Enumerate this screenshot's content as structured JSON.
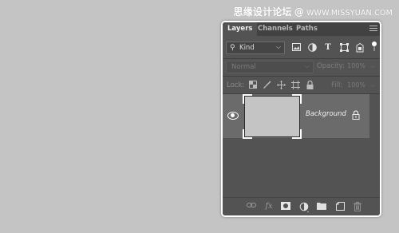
{
  "watermark": {
    "text": "思缘设计论坛",
    "url": "WWW.MISSYUAN.COM"
  },
  "panel": {
    "tabs": [
      {
        "label": "Layers",
        "active": true
      },
      {
        "label": "Channels",
        "active": false
      },
      {
        "label": "Paths",
        "active": false
      }
    ],
    "menu_icon": "panel-menu-icon",
    "filter": {
      "kind_label": "Kind",
      "search_icon": "search-icon",
      "filter_icons": [
        "image-filter-icon",
        "adjustment-filter-icon",
        "type-filter-icon",
        "shape-filter-icon",
        "smart-object-filter-icon"
      ]
    },
    "blend": {
      "mode": "Normal",
      "opacity_label": "Opacity:",
      "opacity_value": "100%"
    },
    "lock": {
      "label": "Lock:",
      "fill_label": "Fill:",
      "fill_value": "100%",
      "lock_icons": [
        "lock-transparent-icon",
        "lock-brush-icon",
        "lock-move-icon",
        "lock-artboard-icon",
        "lock-all-icon"
      ]
    },
    "layers": [
      {
        "name": "Background",
        "visible": true,
        "locked": true
      }
    ],
    "bottom_icons": [
      "link-icon",
      "fx-icon",
      "mask-icon",
      "adjustment-icon",
      "folder-icon",
      "new-layer-icon",
      "trash-icon"
    ]
  },
  "colors": {
    "canvas_bg": "#c4c4c4",
    "panel_bg": "#535353",
    "tabbar_bg": "#424242",
    "selected_layer": "#6b6b6b"
  }
}
